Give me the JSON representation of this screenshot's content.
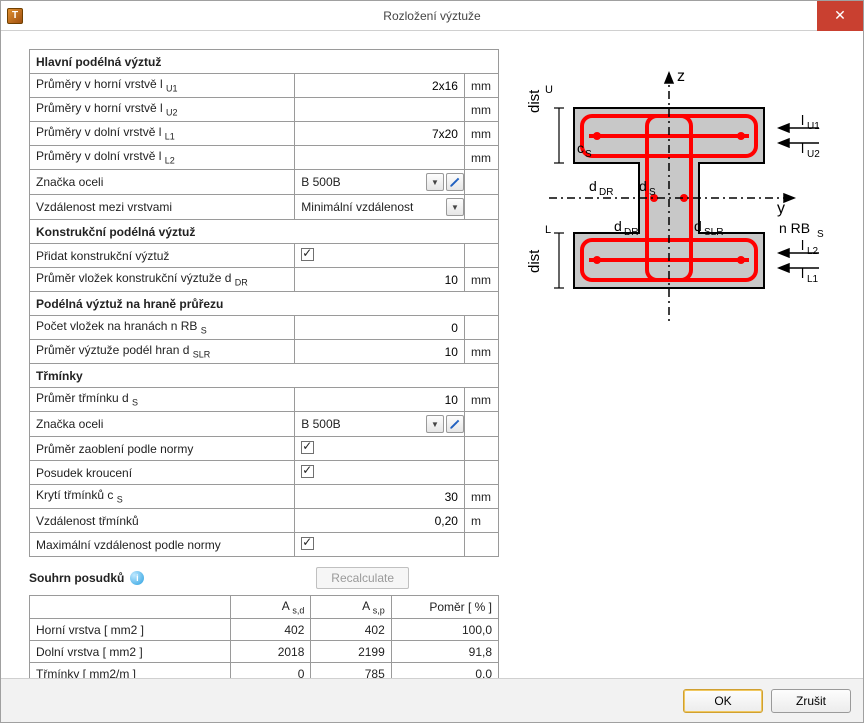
{
  "window": {
    "title": "Rozložení výztuže",
    "icon_letter": "T"
  },
  "sections": {
    "main_long": "Hlavní podélná výztuž",
    "constr_long": "Konstrukční podélná výztuž",
    "edge_long": "Podélná výztuž na hraně průřezu",
    "stirrups": "Třmínky"
  },
  "rows": {
    "diam_u1_label": "Průměry v horní vrstvě  l",
    "diam_u1_sub": "U1",
    "diam_u1_val": "2x16",
    "diam_u2_label": "Průměry v horní vrstvě  l",
    "diam_u2_sub": "U2",
    "diam_u2_val": "",
    "diam_l1_label": "Průměry v dolní vrstvě  l",
    "diam_l1_sub": "L1",
    "diam_l1_val": "7x20",
    "diam_l2_label": "Průměry v dolní vrstvě  l",
    "diam_l2_sub": "L2",
    "diam_l2_val": "",
    "steel1_label": "Značka oceli",
    "steel1_val": "B 500B",
    "layerdist_label": "Vzdálenost mezi vrstvami",
    "layerdist_val": "Minimální vzdálenost",
    "add_constr_label": "Přidat konstrukční výztuž",
    "add_constr_checked": true,
    "ddr_label": "Průměr vložek konstrukční výztuže  d",
    "ddr_sub": "DR",
    "ddr_val": "10",
    "nrbs_label": "Počet vložek na hranách  n RB",
    "nrbs_sub": "S",
    "nrbs_val": "0",
    "dslr_label": "Průměr výztuže podél hran  d",
    "dslr_sub": "SLR",
    "dslr_val": "10",
    "ds_label": "Průměr třmínku  d",
    "ds_sub": "S",
    "ds_val": "10",
    "steel2_label": "Značka oceli",
    "steel2_val": "B 500B",
    "bend_label": "Průměr zaoblení podle normy",
    "bend_checked": true,
    "torsion_label": "Posudek kroucení",
    "torsion_checked": true,
    "cover_label": "Krytí třmínků  c",
    "cover_sub": "S",
    "cover_val": "30",
    "spacing_label": "Vzdálenost třmínků",
    "spacing_val": "0,20",
    "maxdist_label": "Maximální vzdálenost podle normy",
    "maxdist_checked": true
  },
  "units": {
    "mm": "mm",
    "m": "m"
  },
  "summary": {
    "title": "Souhrn posudků",
    "recalc": "Recalculate",
    "headers": {
      "asd": "A",
      "asd_sub": "s,d",
      "asp": "A",
      "asp_sub": "s,p",
      "ratio": "Poměr  [ % ]"
    },
    "rows": [
      {
        "label": "Horní vrstva  [ mm2 ]",
        "asd": "402",
        "asp": "402",
        "ratio": "100,0"
      },
      {
        "label": "Dolní vrstva  [ mm2 ]",
        "asd": "2018",
        "asp": "2199",
        "ratio": "91,8"
      },
      {
        "label": "Třmínky  [ mm2/m ]",
        "asd": "0",
        "asp": "785",
        "ratio": "0,0"
      }
    ]
  },
  "buttons": {
    "ok": "OK",
    "cancel": "Zrušit"
  },
  "diagram_labels": {
    "distU": "distU",
    "distL": "distL",
    "z": "z",
    "y": "y",
    "cs": "cS",
    "ddr1": "dDR",
    "ds": "dS",
    "ddr2": "dDR",
    "dslr": "dSLR",
    "lu1": "lU1",
    "lu2": "lU2",
    "ll1": "lL1",
    "ll2": "lL2",
    "nrbs": "n RBS"
  }
}
